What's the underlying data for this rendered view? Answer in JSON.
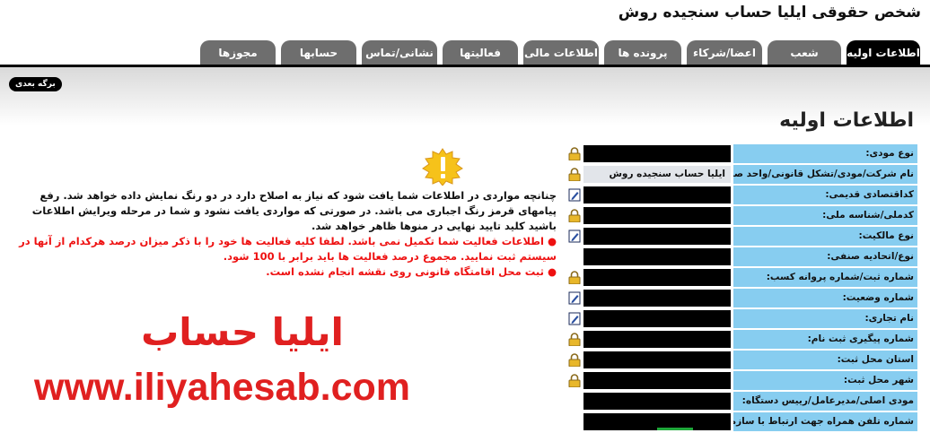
{
  "header": {
    "title": "شخص حقوقی ایلیا حساب سنجیده روش"
  },
  "tabs": [
    {
      "label": "اطلاعات اولیه",
      "active": true
    },
    {
      "label": "شعب"
    },
    {
      "label": "اعضا/شرکاء"
    },
    {
      "label": "پرونده ها"
    },
    {
      "label": "اطلاعات مالی"
    },
    {
      "label": "فعالیتها"
    },
    {
      "label": "نشانی/تماس"
    },
    {
      "label": "حسابها"
    },
    {
      "label": "مجوزها"
    }
  ],
  "next_page_label": "برگه بعدی",
  "section_title": "اطلاعات اولیه",
  "warning": {
    "intro": "چنانچه مواردی در اطلاعات شما یافت شود که نیاز به اصلاح دارد در دو رنگ نمایش داده خواهد شد. رفع پیامهای قرمز رنگ اجباری می باشد. در صورتی که مواردی یافت نشود و شما در مرحله ویرایش اطلاعات باشید کلید تایید نهایی در منوها ظاهر خواهد شد.",
    "items": [
      "اطلاعات فعالیت شما تکمیل نمی باشد. لطفا کلیه فعالیت ها خود را با ذکر میزان درصد هرکدام از آنها در سیستم ثبت نمایید. مجموع درصد فعالیت ها باید برابر با 100 شود.",
      "ثبت محل اقامتگاه قانونی روی نقشه انجام نشده است."
    ]
  },
  "brand": {
    "name": "ایلیا حساب",
    "url": "www.iliyahesab.com"
  },
  "form": {
    "rows": [
      {
        "label": "نوع مودی:",
        "value": "",
        "icon": "lock-icon"
      },
      {
        "label": "نام شرکت/مودی/تشکل قانونی/واحد صنفی:",
        "value": "ایلیا حساب سنجیده روش",
        "icon": "lock-icon"
      },
      {
        "label": "کداقتصادی قدیمی:",
        "value": "",
        "icon": "edit-icon"
      },
      {
        "label": "کدملی/شناسه ملی:",
        "value": "",
        "icon": "lock-icon"
      },
      {
        "label": "نوع مالکیت:",
        "value": "",
        "icon": "edit-icon"
      },
      {
        "label": "نوع/اتحادیه صنفی:",
        "value": "",
        "icon": ""
      },
      {
        "label": "شماره ثبت/شماره پروانه کسب:",
        "value": "",
        "icon": "lock-icon"
      },
      {
        "label": "شماره وضعیت:",
        "value": "",
        "icon": "edit-icon"
      },
      {
        "label": "نام تجاری:",
        "value": "",
        "icon": "edit-icon"
      },
      {
        "label": "شماره پیگیری ثبت نام:",
        "value": "",
        "icon": "lock-icon"
      },
      {
        "label": "استان محل ثبت:",
        "value": "",
        "icon": "lock-icon"
      },
      {
        "label": "شهر محل ثبت:",
        "value": "",
        "icon": "lock-icon"
      },
      {
        "label": "مودی اصلی/مدیرعامل/رییس دستگاه:",
        "value": "",
        "icon": ""
      },
      {
        "label": "شماره تلفن همراه جهت ارتباط با سازمان:",
        "value": "",
        "icon": ""
      }
    ]
  },
  "colors": {
    "label_bg": "#87cdf0",
    "active_tab": "#000000",
    "tab": "#6e6e6e",
    "error_text": "#e11111",
    "brand": "#e02020"
  }
}
